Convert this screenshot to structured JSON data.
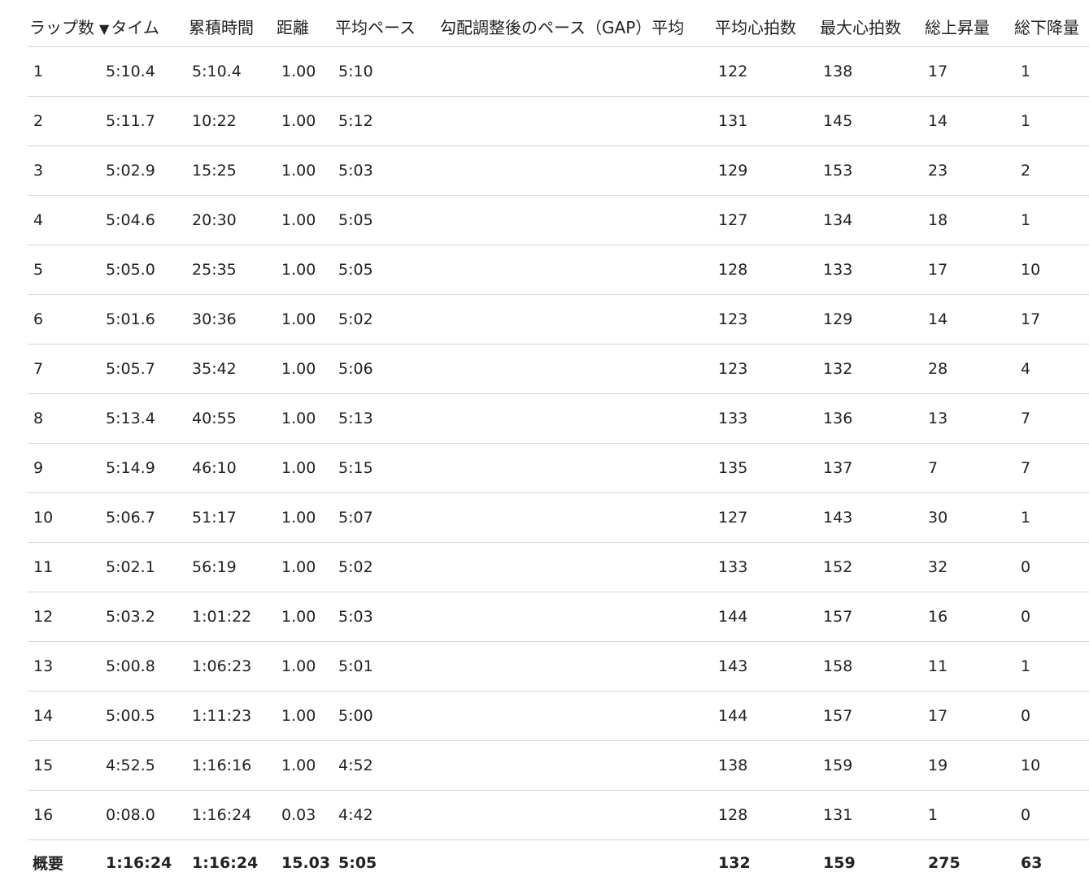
{
  "columns": {
    "lap": "ラップ数",
    "sort_icon": "▼",
    "time": "タイム",
    "cumulative": "累積時間",
    "distance": "距離",
    "avg_pace": "平均ペース",
    "gap": "勾配調整後のペース（GAP）平均",
    "avg_hr": "平均心拍数",
    "max_hr": "最大心拍数",
    "ascent": "総上昇量",
    "descent": "総下降量"
  },
  "rows": [
    [
      "1",
      "5:10.4",
      "5:10.4",
      "1.00",
      "5:10",
      "",
      "122",
      "138",
      "17",
      "1"
    ],
    [
      "2",
      "5:11.7",
      "10:22",
      "1.00",
      "5:12",
      "",
      "131",
      "145",
      "14",
      "1"
    ],
    [
      "3",
      "5:02.9",
      "15:25",
      "1.00",
      "5:03",
      "",
      "129",
      "153",
      "23",
      "2"
    ],
    [
      "4",
      "5:04.6",
      "20:30",
      "1.00",
      "5:05",
      "",
      "127",
      "134",
      "18",
      "1"
    ],
    [
      "5",
      "5:05.0",
      "25:35",
      "1.00",
      "5:05",
      "",
      "128",
      "133",
      "17",
      "10"
    ],
    [
      "6",
      "5:01.6",
      "30:36",
      "1.00",
      "5:02",
      "",
      "123",
      "129",
      "14",
      "17"
    ],
    [
      "7",
      "5:05.7",
      "35:42",
      "1.00",
      "5:06",
      "",
      "123",
      "132",
      "28",
      "4"
    ],
    [
      "8",
      "5:13.4",
      "40:55",
      "1.00",
      "5:13",
      "",
      "133",
      "136",
      "13",
      "7"
    ],
    [
      "9",
      "5:14.9",
      "46:10",
      "1.00",
      "5:15",
      "",
      "135",
      "137",
      "7",
      "7"
    ],
    [
      "10",
      "5:06.7",
      "51:17",
      "1.00",
      "5:07",
      "",
      "127",
      "143",
      "30",
      "1"
    ],
    [
      "11",
      "5:02.1",
      "56:19",
      "1.00",
      "5:02",
      "",
      "133",
      "152",
      "32",
      "0"
    ],
    [
      "12",
      "5:03.2",
      "1:01:22",
      "1.00",
      "5:03",
      "",
      "144",
      "157",
      "16",
      "0"
    ],
    [
      "13",
      "5:00.8",
      "1:06:23",
      "1.00",
      "5:01",
      "",
      "143",
      "158",
      "11",
      "1"
    ],
    [
      "14",
      "5:00.5",
      "1:11:23",
      "1.00",
      "5:00",
      "",
      "144",
      "157",
      "17",
      "0"
    ],
    [
      "15",
      "4:52.5",
      "1:16:16",
      "1.00",
      "4:52",
      "",
      "138",
      "159",
      "19",
      "10"
    ],
    [
      "16",
      "0:08.0",
      "1:16:24",
      "0.03",
      "4:42",
      "",
      "128",
      "131",
      "1",
      "0"
    ]
  ],
  "summary": [
    "概要",
    "1:16:24",
    "1:16:24",
    "15.03",
    "5:05",
    "",
    "132",
    "159",
    "275",
    "63"
  ]
}
